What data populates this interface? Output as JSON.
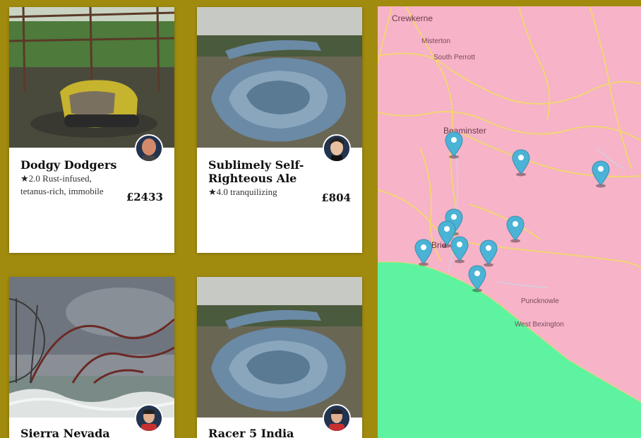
{
  "cards": [
    {
      "title": "Dodgy Dodgers",
      "rating": "2.0",
      "description": "Rust-infused, tetanus-rich, immobile",
      "price": "£2433",
      "image": "abandoned-bumper-car-photo",
      "avatar": "bald-man-avatar"
    },
    {
      "title": "Sublimely Self-Righteous Ale",
      "rating": "4.0",
      "description": "tranquilizing",
      "price": "£804",
      "image": "abandoned-waterslide-photo",
      "avatar": "woman-avatar"
    },
    {
      "title": "Sierra Nevada",
      "image": "flooded-rollercoaster-photo",
      "avatar": "red-shirt-man-avatar"
    },
    {
      "title": "Racer 5 India",
      "image": "abandoned-waterslide-photo",
      "avatar": "red-shirt-man-avatar"
    }
  ],
  "map": {
    "land_color": "#f7b3c8",
    "sea_color": "#5ef3a0",
    "road_color": "#f2d96b",
    "pin_color": "#4ab3d6",
    "towns": [
      "Crewkerne",
      "Misterton",
      "South Perrott",
      "Beaminster",
      "Brid",
      "Puncknowle",
      "West Bexington"
    ],
    "pin_icon": "map-marker-icon"
  }
}
